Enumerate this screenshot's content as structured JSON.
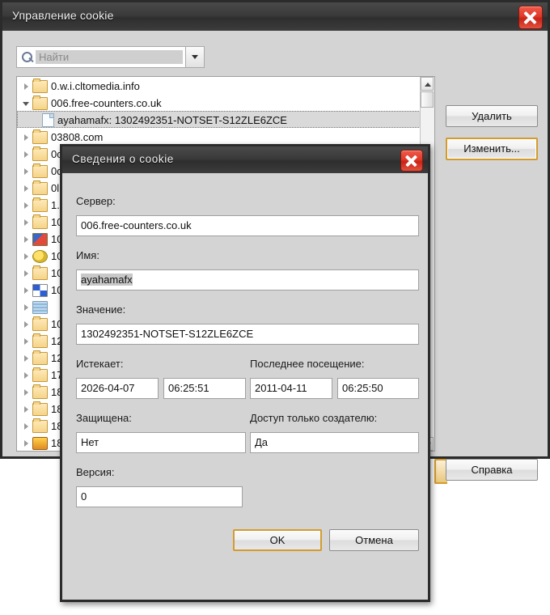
{
  "window": {
    "title": "Управление cookie",
    "close_icon": "close-icon"
  },
  "search": {
    "placeholder": "Найти",
    "value": "",
    "icon": "search-icon",
    "dropdown_icon": "chevron-down-icon"
  },
  "tree": {
    "rows": [
      {
        "label": "0.w.i.cltomedia.info",
        "icon": "folder-icon",
        "arrow": "closed",
        "depth": 0,
        "selected": false
      },
      {
        "label": "006.free-counters.co.uk",
        "icon": "folder-icon",
        "arrow": "open",
        "depth": 0,
        "selected": false
      },
      {
        "label": "ayahamafx: 1302492351-NOTSET-S12ZLE6ZCE",
        "icon": "document-icon",
        "arrow": "none",
        "depth": 1,
        "selected": true
      },
      {
        "label": "03808.com",
        "icon": "folder-icon",
        "arrow": "closed",
        "depth": 0,
        "selected": false
      },
      {
        "label": "0ca",
        "icon": "folder-icon",
        "arrow": "closed",
        "depth": 0,
        "selected": false
      },
      {
        "label": "0dd",
        "icon": "folder-icon",
        "arrow": "closed",
        "depth": 0,
        "selected": false
      },
      {
        "label": "0lik",
        "icon": "folder-icon",
        "arrow": "closed",
        "depth": 0,
        "selected": false
      },
      {
        "label": "1.g",
        "icon": "folder-icon",
        "arrow": "closed",
        "depth": 0,
        "selected": false
      },
      {
        "label": "100",
        "icon": "folder-icon",
        "arrow": "closed",
        "depth": 0,
        "selected": false
      },
      {
        "label": "100",
        "icon": "favicon-1",
        "arrow": "closed",
        "depth": 0,
        "selected": false
      },
      {
        "label": "100",
        "icon": "favicon-2",
        "arrow": "closed",
        "depth": 0,
        "selected": false
      },
      {
        "label": "100",
        "icon": "folder-icon",
        "arrow": "closed",
        "depth": 0,
        "selected": false
      },
      {
        "label": "100",
        "icon": "favicon-3",
        "arrow": "closed",
        "depth": 0,
        "selected": false
      },
      {
        "label": "",
        "icon": "favicon-4",
        "arrow": "closed",
        "depth": 0,
        "selected": false
      },
      {
        "label": "10x",
        "icon": "folder-icon",
        "arrow": "closed",
        "depth": 0,
        "selected": false
      },
      {
        "label": "123",
        "icon": "folder-icon",
        "arrow": "closed",
        "depth": 0,
        "selected": false
      },
      {
        "label": "123",
        "icon": "folder-icon",
        "arrow": "closed",
        "depth": 0,
        "selected": false
      },
      {
        "label": "174",
        "icon": "folder-icon",
        "arrow": "closed",
        "depth": 0,
        "selected": false
      },
      {
        "label": "18f",
        "icon": "folder-icon",
        "arrow": "closed",
        "depth": 0,
        "selected": false
      },
      {
        "label": "18p",
        "icon": "folder-icon",
        "arrow": "closed",
        "depth": 0,
        "selected": false
      },
      {
        "label": "18s",
        "icon": "folder-icon",
        "arrow": "closed",
        "depth": 0,
        "selected": false
      },
      {
        "label": "18t",
        "icon": "favicon-5",
        "arrow": "closed",
        "depth": 0,
        "selected": false
      }
    ],
    "scroll_up_icon": "scroll-up-arrow-icon",
    "scroll_down_icon": "scroll-down-arrow-icon"
  },
  "buttons": {
    "delete": "Удалить",
    "edit": "Изменить...",
    "help": "Справка"
  },
  "dialog": {
    "title": "Сведения о cookie",
    "close_icon": "close-icon",
    "labels": {
      "server": "Сервер:",
      "name": "Имя:",
      "value": "Значение:",
      "expires": "Истекает:",
      "last_visit": "Последнее посещение:",
      "secure": "Защищена:",
      "http_only": "Доступ только создателю:",
      "version": "Версия:"
    },
    "fields": {
      "server": "006.free-counters.co.uk",
      "name": "ayahamafx",
      "value": "1302492351-NOTSET-S12ZLE6ZCE",
      "expires_date": "2026-04-07",
      "expires_time": "06:25:51",
      "last_visit_date": "2011-04-11",
      "last_visit_time": "06:25:50",
      "secure": "Нет",
      "http_only": "Да",
      "version": "0"
    },
    "buttons": {
      "ok": "OK",
      "cancel": "Отмена"
    }
  },
  "colors": {
    "titlebar": "#3a3a3a",
    "close_red": "#d8331f",
    "focus_orange": "#d39b2e",
    "dialog_bg": "#d4d4d4",
    "selection_gray": "#c8c8c8"
  }
}
